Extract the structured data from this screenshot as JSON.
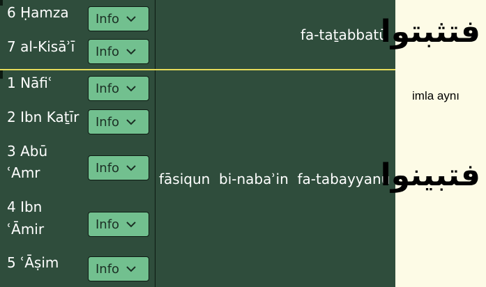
{
  "groups": [
    {
      "phrase": "fa-taṯabbatū",
      "arabic": "فتثبتوا",
      "readers": [
        {
          "name": "6 Ḥamza",
          "button": "Info"
        },
        {
          "name": "7 al-Kisāʾī",
          "button": "Info"
        }
      ]
    },
    {
      "phrase": "fāsiqun  bi-nabaʾin  fa-tabayyanū",
      "arabic": "فتبينوا",
      "readers": [
        {
          "name": "1 Nāfiʿ",
          "button": "Info"
        },
        {
          "name": "2 Ibn Kaṯīr",
          "button": "Info"
        },
        {
          "name_line1": "3 Abū",
          "name_line2": "ʿAmr",
          "button": "Info"
        },
        {
          "name_line1": "4 Ibn",
          "name_line2": "ʿĀmir",
          "button": "Info"
        },
        {
          "name": "5 ʿĀṣim",
          "button": "Info"
        }
      ]
    }
  ],
  "side_note": "imla aynı",
  "colors": {
    "panel": "#2f4d3c",
    "button": "#72c08f",
    "divider": "#e6dd5a",
    "page": "#fdfbe6"
  }
}
